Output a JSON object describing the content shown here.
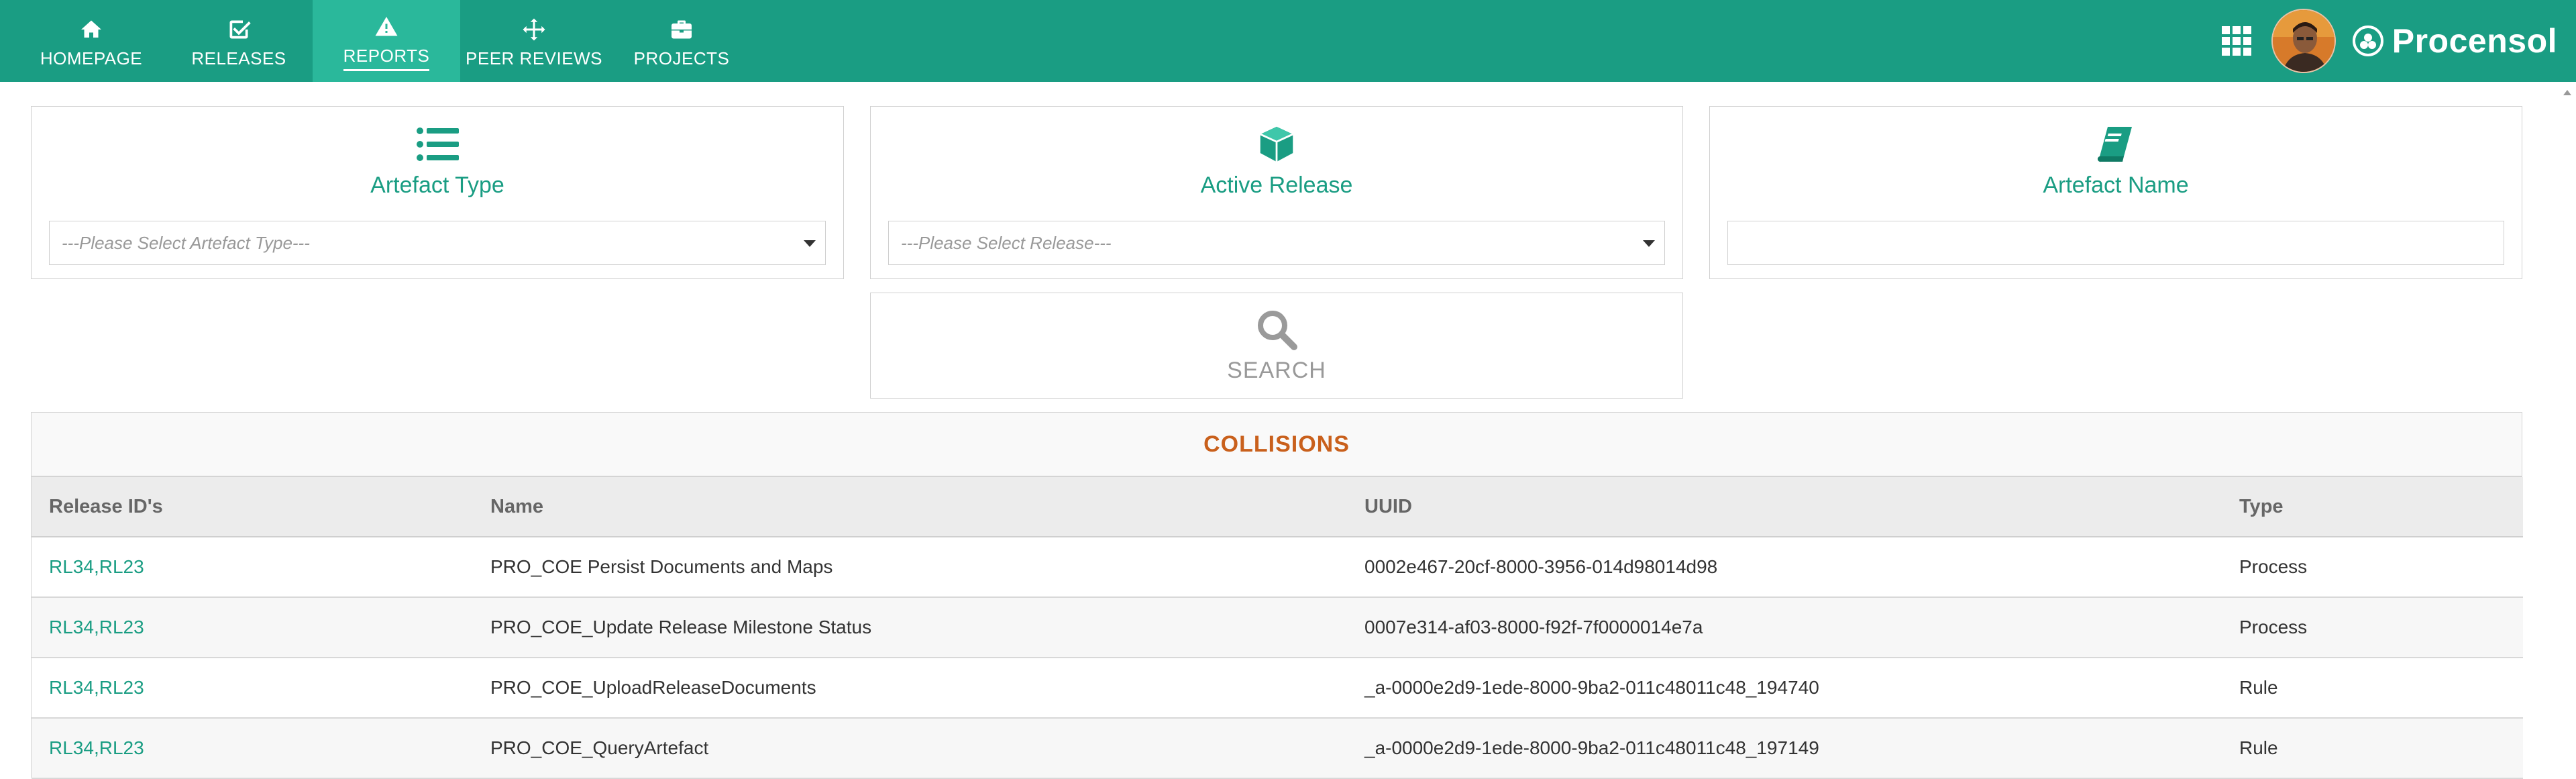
{
  "nav": {
    "items": [
      {
        "label": "HOMEPAGE",
        "icon": "home-icon"
      },
      {
        "label": "RELEASES",
        "icon": "checkbox-icon"
      },
      {
        "label": "REPORTS",
        "icon": "warning-icon",
        "active": true
      },
      {
        "label": "PEER REVIEWS",
        "icon": "move-arrows-icon"
      },
      {
        "label": "PROJECTS",
        "icon": "briefcase-icon"
      }
    ],
    "brand": "Procensol",
    "color": "#1a9d83",
    "active_color": "#2ab89b"
  },
  "filters": {
    "artefact_type": {
      "title": "Artefact Type",
      "placeholder": "---Please Select Artefact Type---",
      "icon": "list-icon"
    },
    "active_release": {
      "title": "Active Release",
      "placeholder": "---Please Select Release---",
      "icon": "cube-icon"
    },
    "artefact_name": {
      "title": "Artefact Name",
      "value": "",
      "icon": "book-icon"
    },
    "search": {
      "label": "SEARCH",
      "icon": "search-icon"
    }
  },
  "collisions": {
    "title": "COLLISIONS",
    "title_color": "#c9601c",
    "columns": [
      "Release ID's",
      "Name",
      "UUID",
      "Type"
    ],
    "rows": [
      {
        "release_ids": "RL34,RL23",
        "name": "PRO_COE Persist Documents and Maps",
        "uuid": "0002e467-20cf-8000-3956-014d98014d98",
        "type": "Process"
      },
      {
        "release_ids": "RL34,RL23",
        "name": "PRO_COE_Update Release Milestone Status",
        "uuid": "0007e314-af03-8000-f92f-7f0000014e7a",
        "type": "Process"
      },
      {
        "release_ids": "RL34,RL23",
        "name": "PRO_COE_UploadReleaseDocuments",
        "uuid": "_a-0000e2d9-1ede-8000-9ba2-011c48011c48_194740",
        "type": "Rule"
      },
      {
        "release_ids": "RL34,RL23",
        "name": "PRO_COE_QueryArtefact",
        "uuid": "_a-0000e2d9-1ede-8000-9ba2-011c48011c48_197149",
        "type": "Rule"
      }
    ]
  }
}
